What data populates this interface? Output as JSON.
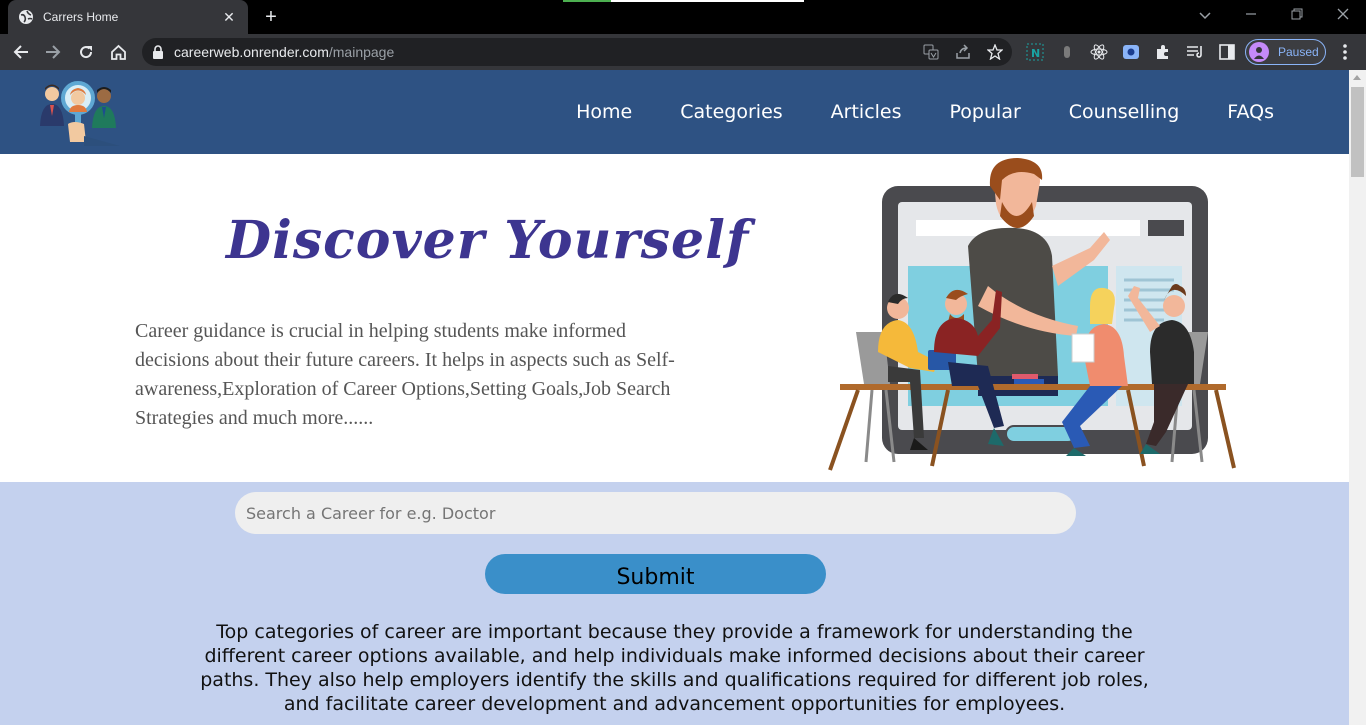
{
  "browser": {
    "tab_title": "Carrers Home",
    "tab_close_glyph": "✕",
    "new_tab_glyph": "+",
    "url_host": "careerweb.onrender.com",
    "url_path": "/mainpage",
    "profile_label": "Paused",
    "icons": [
      "globe-icon",
      "back-icon",
      "forward-icon",
      "reload-icon",
      "home-icon",
      "lock-icon",
      "translate-icon",
      "share-icon",
      "star-icon",
      "extensions-icon",
      "reading-list-icon",
      "side-panel-icon",
      "menu-icon"
    ]
  },
  "site": {
    "nav": {
      "home": "Home",
      "categories": "Categories",
      "articles": "Articles",
      "popular": "Popular",
      "counselling": "Counselling",
      "faqs": "FAQs"
    },
    "hero": {
      "title": "Discover Yourself",
      "text": "Career guidance is crucial in helping students make informed decisions about their future careers. It helps in aspects such as Self-awareness,Exploration of Career Options,Setting Goals,Job Search Strategies and much more......"
    },
    "search": {
      "placeholder": "Search a Career for e.g. Doctor",
      "submit_label": "Submit"
    },
    "categories_text": "Top categories of career are important because they provide a framework for understanding the different career options available, and help individuals make informed decisions about their career paths. They also help employers identify the skills and qualifications required for different job roles, and facilitate career development and advancement opportunities for employees."
  },
  "colors": {
    "header_bg": "#2e5283",
    "hero_title": "#3d3590",
    "search_band_bg": "#c4d1ee",
    "submit_bg": "#3a8fc9"
  }
}
